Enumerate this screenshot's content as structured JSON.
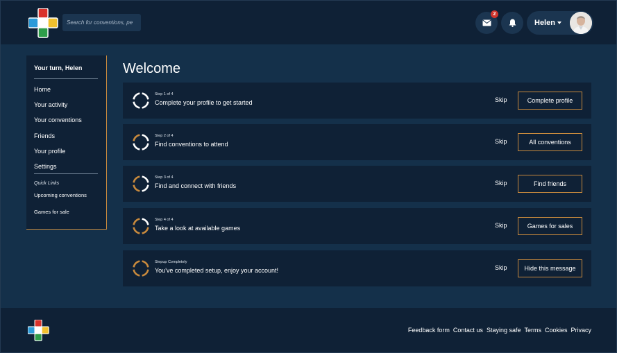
{
  "header": {
    "search_placeholder": "Search for conventions, pe",
    "mail_badge": "2",
    "user_name": "Helen"
  },
  "sidebar": {
    "title": "Your turn, Helen",
    "items": [
      "Home",
      "Your activity",
      "Your conventions",
      "Friends",
      "Your profile",
      "Settings"
    ],
    "quick_links_label": "Quick Links",
    "quick_links": [
      "Upcoming conventions",
      "Games for sale"
    ]
  },
  "main": {
    "title": "Welcome",
    "steps": [
      {
        "kicker": "Step 1 of 4",
        "text": "Complete your profile to get started",
        "skip": "Skip",
        "action": "Complete profile",
        "progress": 0
      },
      {
        "kicker": "Step 2 of 4",
        "text": "Find conventions to attend",
        "skip": "Skip",
        "action": "All conventions",
        "progress": 0.25
      },
      {
        "kicker": "Step 3 of 4",
        "text": "Find and connect with friends",
        "skip": "Skip",
        "action": "Find friends",
        "progress": 0.5
      },
      {
        "kicker": "Step 4 of 4",
        "text": "Take a look at available games",
        "skip": "Skip",
        "action": "Games for sales",
        "progress": 0.75
      },
      {
        "kicker": "Stepup Completely",
        "text": "You've completed setup, enjoy your account!",
        "skip": "Skip",
        "action": "Hide this message",
        "progress": 1
      }
    ]
  },
  "footer": {
    "links": [
      "Feedback form",
      "Contact us",
      "Staying safe",
      "Terms",
      "Cookies",
      "Privacy"
    ]
  },
  "colors": {
    "accent": "#c98a3d",
    "background": "#0f2136",
    "panel": "#14304a",
    "badge": "#d0342c"
  },
  "icons": {
    "logo": "colored-cross-logo",
    "mail": "mail-icon",
    "bell": "bell-icon",
    "caret": "caret-down-icon",
    "step": "progress-ring-icon"
  }
}
